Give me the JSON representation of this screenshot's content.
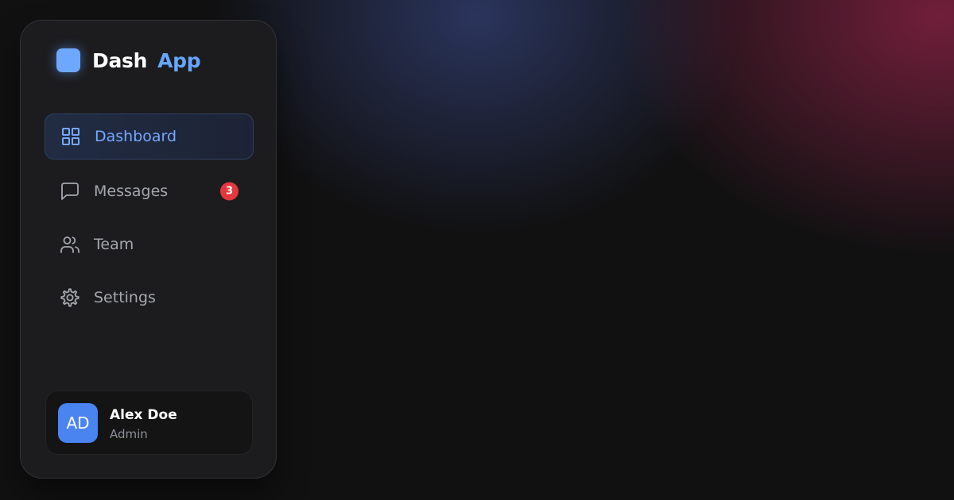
{
  "colors": {
    "background": "#111112",
    "sidebar": "#1c1c1e",
    "accent": "#66a6ff",
    "badge": "#e5383c",
    "avatar": "#4a84f1"
  },
  "brand": {
    "name": "Dash",
    "accent": "App",
    "logo_icon": "rounded-square-logo"
  },
  "nav": {
    "items": [
      {
        "label": "Dashboard",
        "icon": "grid-icon",
        "active": true
      },
      {
        "label": "Messages",
        "icon": "message-square-icon",
        "badge": "3"
      },
      {
        "label": "Team",
        "icon": "users-icon"
      },
      {
        "label": "Settings",
        "icon": "gear-icon"
      }
    ]
  },
  "profile": {
    "initials": "AD",
    "name": "Alex Doe",
    "role": "Admin"
  }
}
